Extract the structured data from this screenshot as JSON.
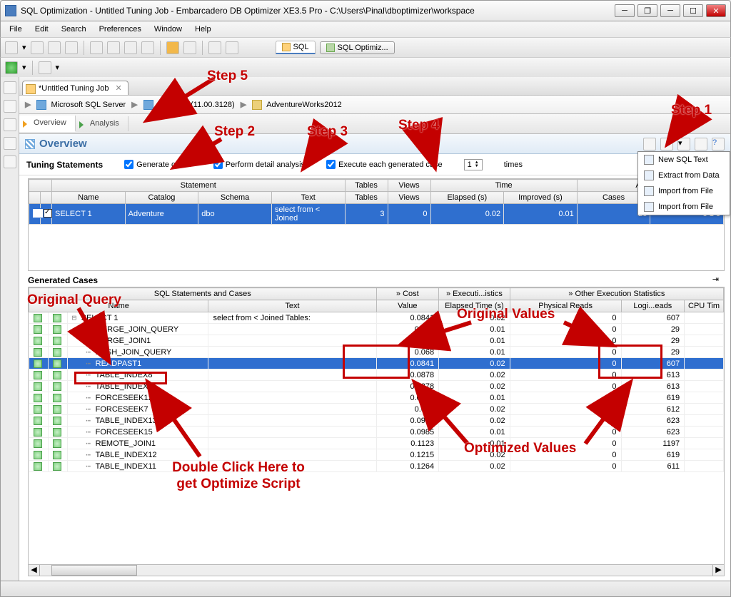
{
  "window": {
    "title": "SQL Optimization - Untitled Tuning Job - Embarcadero DB Optimizer XE3.5 Pro - C:\\Users\\Pinal\\dboptimizer\\workspace"
  },
  "menu": {
    "items": [
      "File",
      "Edit",
      "Search",
      "Preferences",
      "Window",
      "Help"
    ]
  },
  "toolbar2": {
    "sql_tab": "SQL",
    "optimize_tab": "SQL Optimiz..."
  },
  "editor": {
    "tab_title": "*Untitled Tuning Job"
  },
  "breadcrumb": {
    "server": "Microsoft SQL Server",
    "host": "localhost (11.00.3128)",
    "db": "AdventureWorks2012"
  },
  "subtabs": {
    "overview": "Overview",
    "analysis": "Analysis"
  },
  "overview": {
    "title": "Overview"
  },
  "tuning": {
    "title": "Tuning Statements",
    "generate": "Generate cases",
    "detail": "Perform detail analysis",
    "execute": "Execute each generated case",
    "times_value": "1",
    "times_label": "times"
  },
  "toptable": {
    "group_statement": "Statement",
    "group_time": "Time",
    "group_analysis": "Analysis",
    "cols": [
      "Name",
      "Catalog",
      "Schema",
      "Text",
      "Tables",
      "Views",
      "Elapsed (s)",
      "Improved (s)",
      "Cases",
      "Indexes"
    ],
    "row": {
      "name": "SELECT 1",
      "catalog": "Adventure",
      "schema": "dbo",
      "text": "select from < Joined",
      "tables": "3",
      "views": "0",
      "elapsed": "0.02",
      "improved": "0.01",
      "cases": "23",
      "idx": "3  1  8"
    }
  },
  "gen": {
    "title": "Generated Cases",
    "group_sc": "SQL Statements and Cases",
    "group_cost": "Cost",
    "group_exec": "Executi...istics",
    "group_other": "Other Execution Statistics",
    "cols": {
      "name": "Name",
      "text": "Text",
      "value": "Value",
      "elapsed": "Elapsed Time (s)",
      "phys": "Physical Reads",
      "logi": "Logi...eads",
      "cpu": "CPU Tim"
    },
    "rows": [
      {
        "name": "SELECT 1",
        "text": "select from < Joined Tables:",
        "value": "0.0841",
        "elapsed": "0.02",
        "phys": "0",
        "logi": "607",
        "root": true
      },
      {
        "name": "MERGE_JOIN_QUERY",
        "text": "",
        "value": "0.044",
        "elapsed": "0.01",
        "phys": "0",
        "logi": "29"
      },
      {
        "name": "MERGE_JOIN1",
        "text": "",
        "value": "0.0451",
        "elapsed": "0.01",
        "phys": "0",
        "logi": "29"
      },
      {
        "name": "HASH_JOIN_QUERY",
        "text": "",
        "value": "0.068",
        "elapsed": "0.01",
        "phys": "0",
        "logi": "29"
      },
      {
        "name": "READPAST1",
        "text": "",
        "value": "0.0841",
        "elapsed": "0.02",
        "phys": "0",
        "logi": "607",
        "sel": true
      },
      {
        "name": "TABLE_INDEX8",
        "text": "",
        "value": "0.0878",
        "elapsed": "0.02",
        "phys": "0",
        "logi": "613"
      },
      {
        "name": "TABLE_INDEX9",
        "text": "",
        "value": "0.0878",
        "elapsed": "0.02",
        "phys": "0",
        "logi": "613"
      },
      {
        "name": "FORCESEEK12",
        "text": "",
        "value": "0.0964",
        "elapsed": "0.01",
        "phys": "0",
        "logi": "619"
      },
      {
        "name": "FORCESEEK7",
        "text": "",
        "value": "0.097",
        "elapsed": "0.02",
        "phys": "0",
        "logi": "612"
      },
      {
        "name": "TABLE_INDEX13",
        "text": "",
        "value": "0.0981",
        "elapsed": "0.02",
        "phys": "0",
        "logi": "623"
      },
      {
        "name": "FORCESEEK15",
        "text": "",
        "value": "0.0985",
        "elapsed": "0.01",
        "phys": "0",
        "logi": "623"
      },
      {
        "name": "REMOTE_JOIN1",
        "text": "",
        "value": "0.1123",
        "elapsed": "0.01",
        "phys": "0",
        "logi": "1197"
      },
      {
        "name": "TABLE_INDEX12",
        "text": "",
        "value": "0.1215",
        "elapsed": "0.02",
        "phys": "0",
        "logi": "619"
      },
      {
        "name": "TABLE_INDEX11",
        "text": "",
        "value": "0.1264",
        "elapsed": "0.02",
        "phys": "0",
        "logi": "611"
      }
    ]
  },
  "popup": {
    "items": [
      "New SQL Text",
      "Extract from Data",
      "Import from File",
      "Import from File"
    ]
  },
  "ann": {
    "step1": "Step 1",
    "step2": "Step 2",
    "step3": "Step 3",
    "step4": "Step 4",
    "step5": "Step 5",
    "origq": "Original Query",
    "origv": "Original Values",
    "optv": "Optimized  Values",
    "dbl": "Double Click Here to get Optimize Script"
  }
}
